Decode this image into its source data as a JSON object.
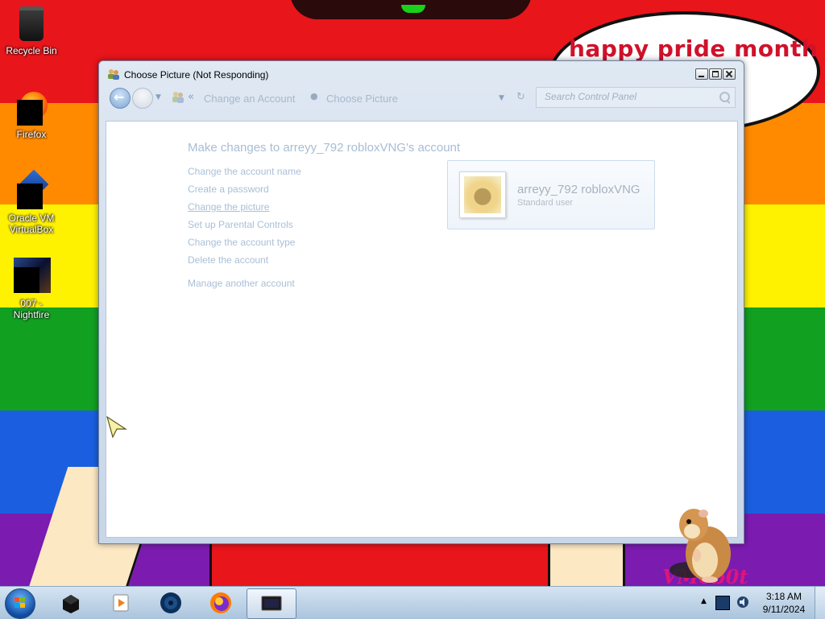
{
  "desktop": {
    "bubble_text": "happy pride month",
    "watermark": "VM0b0t",
    "icons": [
      {
        "name": "recycle-bin",
        "label": "Recycle Bin"
      },
      {
        "name": "firefox",
        "label": "Firefox"
      },
      {
        "name": "oracle-vm-virtualbox",
        "label": "Oracle VM VirtualBox"
      },
      {
        "name": "007-nightfire",
        "label": "007 - Nightfire"
      }
    ]
  },
  "window": {
    "title": "Choose Picture (Not Responding)",
    "breadcrumb": [
      "Change an Account",
      "Choose Picture"
    ],
    "search_placeholder": "Search Control Panel",
    "heading": "Make changes to arreyy_792 robloxVNG's account",
    "links": [
      "Change the account name",
      "Create a password",
      "Change the picture",
      "Set up Parental Controls",
      "Change the account type",
      "Delete the account",
      "Manage another account"
    ],
    "account": {
      "name": "arreyy_792 robloxVNG",
      "type": "Standard user"
    }
  },
  "taskbar": {
    "items": [
      "virtualbox",
      "media-player",
      "game",
      "firefox",
      "control-panel"
    ],
    "active_item": "control-panel"
  },
  "clock": {
    "time": "3:18 AM",
    "date": "9/11/2024"
  },
  "colors": {
    "rainbow": [
      "#e8151b",
      "#ff8a00",
      "#fff200",
      "#12a020",
      "#1b5fe0",
      "#7b1bb0"
    ],
    "link": "#a9bfd6",
    "bubble_text": "#d0112b"
  }
}
